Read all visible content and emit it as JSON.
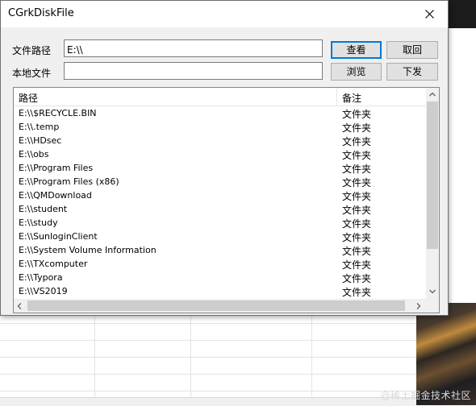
{
  "dialog": {
    "title": "CGrkDiskFile",
    "path_label": "文件路径",
    "path_value": "E:\\\\",
    "local_label": "本地文件",
    "local_value": "",
    "view_button": "查看",
    "cancel_button": "取回",
    "browse_button": "浏览",
    "download_button": "下发"
  },
  "list": {
    "columns": [
      "路径",
      "备注"
    ],
    "rows": [
      {
        "path": "E:\\\\$RECYCLE.BIN",
        "note": "文件夹"
      },
      {
        "path": "E:\\\\.temp",
        "note": "文件夹"
      },
      {
        "path": "E:\\\\HDsec",
        "note": "文件夹"
      },
      {
        "path": "E:\\\\obs",
        "note": "文件夹"
      },
      {
        "path": "E:\\\\Program Files",
        "note": "文件夹"
      },
      {
        "path": "E:\\\\Program Files (x86)",
        "note": "文件夹"
      },
      {
        "path": "E:\\\\QMDownload",
        "note": "文件夹"
      },
      {
        "path": "E:\\\\student",
        "note": "文件夹"
      },
      {
        "path": "E:\\\\study",
        "note": "文件夹"
      },
      {
        "path": "E:\\\\SunloginClient",
        "note": "文件夹"
      },
      {
        "path": "E:\\\\System Volume Information",
        "note": "文件夹"
      },
      {
        "path": "E:\\\\TXcomputer",
        "note": "文件夹"
      },
      {
        "path": "E:\\\\Typora",
        "note": "文件夹"
      },
      {
        "path": "E:\\\\VS2019",
        "note": "文件夹"
      }
    ]
  },
  "watermark": "@稀土掘金技术社区"
}
